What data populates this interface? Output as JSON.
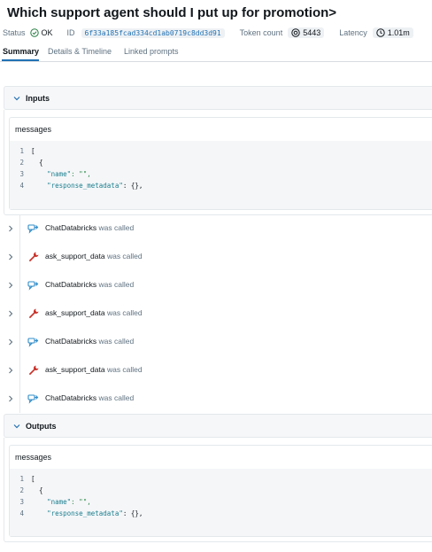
{
  "header": {
    "title": "Which support agent should I put up for promotion>",
    "status_label": "Status",
    "status_value": "OK",
    "id_label": "ID",
    "id_value": "6f33a185fcad334cd1ab0719c8dd3d91",
    "token_label": "Token count",
    "token_value": "5443",
    "latency_label": "Latency",
    "latency_value": "1.01m"
  },
  "tabs": [
    {
      "label": "Summary",
      "active": true
    },
    {
      "label": "Details & Timeline",
      "active": false
    },
    {
      "label": "Linked prompts",
      "active": false
    }
  ],
  "inputs": {
    "label": "Inputs",
    "card_title": "messages",
    "lines": [
      {
        "n": "1",
        "a": "[",
        "key": "",
        "b": ""
      },
      {
        "n": "2",
        "a": "  {",
        "key": "",
        "b": ""
      },
      {
        "n": "3",
        "a": "    ",
        "key": "\"name\"",
        "b": ": \"\","
      },
      {
        "n": "4",
        "a": "    ",
        "key": "\"response_metadata\"",
        "b": ": {},"
      }
    ]
  },
  "calls": [
    {
      "name": "ChatDatabricks",
      "suffix": "was called",
      "icon": "chat-model-icon"
    },
    {
      "name": "ask_support_data",
      "suffix": "was called",
      "icon": "tool-wrench-icon"
    },
    {
      "name": "ChatDatabricks",
      "suffix": "was called",
      "icon": "chat-model-icon"
    },
    {
      "name": "ask_support_data",
      "suffix": "was called",
      "icon": "tool-wrench-icon"
    },
    {
      "name": "ChatDatabricks",
      "suffix": "was called",
      "icon": "chat-model-icon"
    },
    {
      "name": "ask_support_data",
      "suffix": "was called",
      "icon": "tool-wrench-icon"
    },
    {
      "name": "ChatDatabricks",
      "suffix": "was called",
      "icon": "chat-model-icon"
    }
  ],
  "outputs": {
    "label": "Outputs",
    "card_title": "messages",
    "lines": [
      {
        "n": "1",
        "a": "[",
        "key": "",
        "b": ""
      },
      {
        "n": "2",
        "a": "  {",
        "key": "",
        "b": ""
      },
      {
        "n": "3",
        "a": "    ",
        "key": "\"name\"",
        "b": ": \"\","
      },
      {
        "n": "4",
        "a": "    ",
        "key": "\"response_metadata\"",
        "b": ": {},"
      }
    ]
  },
  "colors": {
    "accent": "#2272b4",
    "ok_green": "#277c43",
    "tool_red": "#c8322a",
    "chat_blue": "#2f8cc9"
  }
}
